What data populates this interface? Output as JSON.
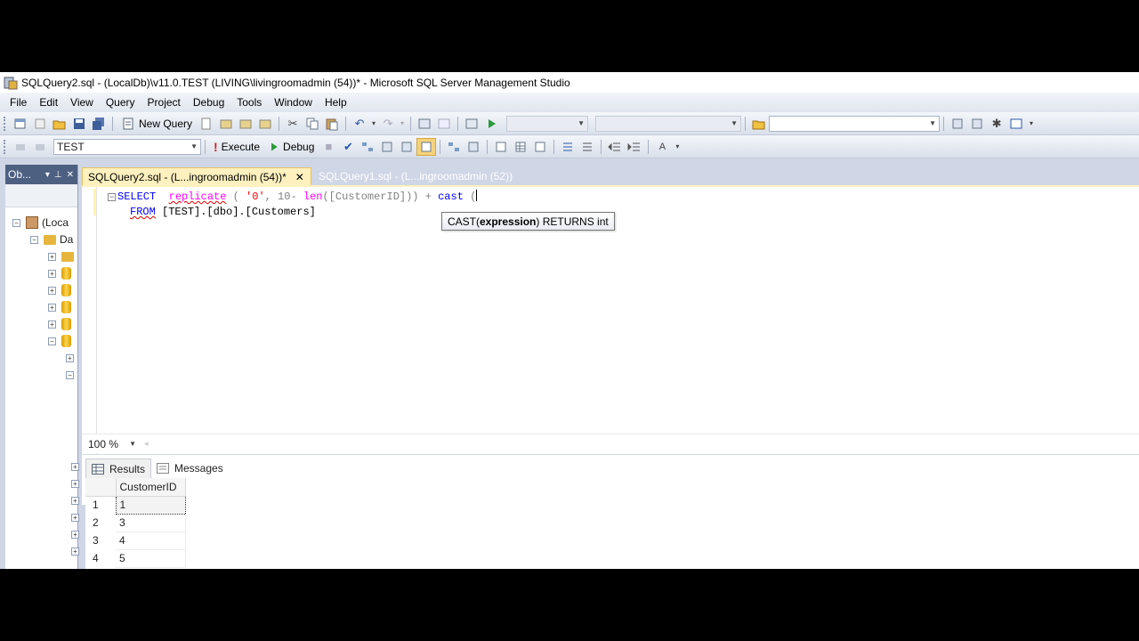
{
  "window": {
    "title": "SQLQuery2.sql - (LocalDb)\\v11.0.TEST (LIVING\\livingroomadmin (54))* - Microsoft SQL Server Management Studio"
  },
  "menu": [
    "File",
    "Edit",
    "View",
    "Query",
    "Project",
    "Debug",
    "Tools",
    "Window",
    "Help"
  ],
  "toolbar1": {
    "new_query": "New Query"
  },
  "toolbar2": {
    "database": "TEST",
    "execute": "Execute",
    "debug": "Debug"
  },
  "object_explorer": {
    "title": "Ob...",
    "root": "(Loca",
    "folder": "Da"
  },
  "tabs": [
    {
      "label": "SQLQuery2.sql - (L...ingroomadmin (54))*",
      "active": true
    },
    {
      "label": "SQLQuery1.sql - (L...ingroomadmin (52))",
      "active": false
    }
  ],
  "editor": {
    "line1": {
      "select": "SELECT",
      "replicate": "replicate",
      "open": " ( ",
      "zero": "'0'",
      "ten": ", 10- ",
      "len": "len",
      "arg": "([CustomerID])) + ",
      "cast": "cast",
      "paren": " ("
    },
    "line2": {
      "from": "FROM",
      "table": " [TEST].[dbo].[Customers]"
    }
  },
  "tooltip": {
    "prefix": "CAST(",
    "bold": "expression",
    "suffix": ") RETURNS int"
  },
  "zoom": "100 %",
  "results": {
    "tabs": [
      "Results",
      "Messages"
    ],
    "column": "CustomerID",
    "rows": [
      {
        "n": "1",
        "v": "1"
      },
      {
        "n": "2",
        "v": "3"
      },
      {
        "n": "3",
        "v": "4"
      },
      {
        "n": "4",
        "v": "5"
      }
    ]
  }
}
